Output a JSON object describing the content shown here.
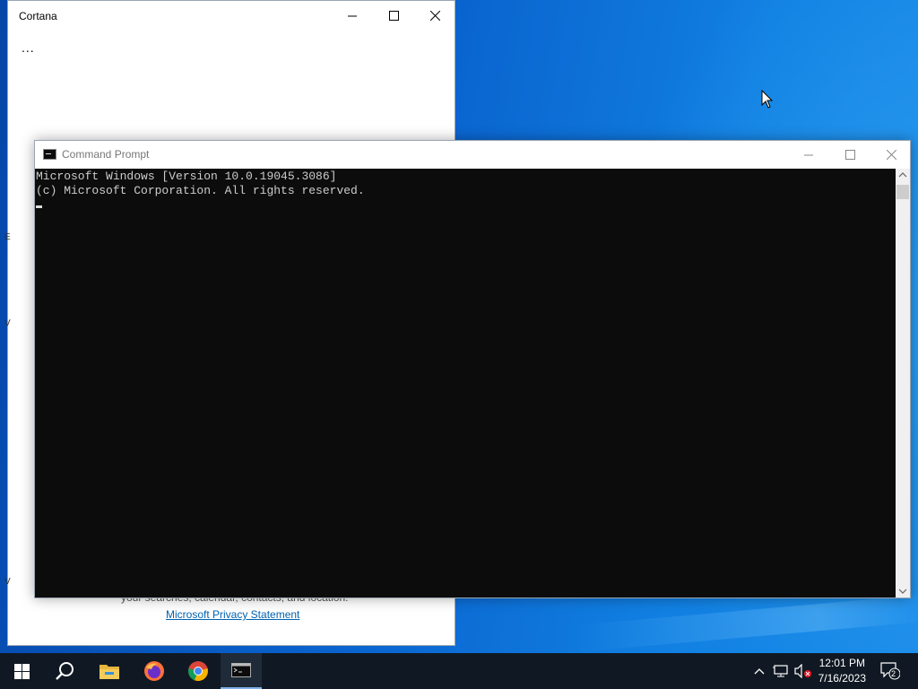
{
  "desktop": {
    "background_colors": [
      "#0646a8",
      "#1a8ae8"
    ]
  },
  "cortana": {
    "title": "Cortana",
    "more": "...",
    "faded_text": "your searches, calendar, contacts, and location.",
    "privacy_link": "Microsoft Privacy Statement",
    "edge_letters": [
      "E",
      "V",
      "V"
    ]
  },
  "cmd": {
    "title": "Command Prompt",
    "lines": [
      "Microsoft Windows [Version 10.0.19045.3086]",
      "(c) Microsoft Corporation. All rights reserved."
    ]
  },
  "taskbar": {
    "items": [
      "start-icon",
      "search-icon",
      "file-explorer-icon",
      "firefox-icon",
      "chrome-icon",
      "command-prompt-icon"
    ],
    "time": "12:01 PM",
    "date": "7/16/2023",
    "notification_count": "2",
    "colors": {
      "bar": "#101923",
      "active_underline": "#7fb3e6"
    }
  }
}
